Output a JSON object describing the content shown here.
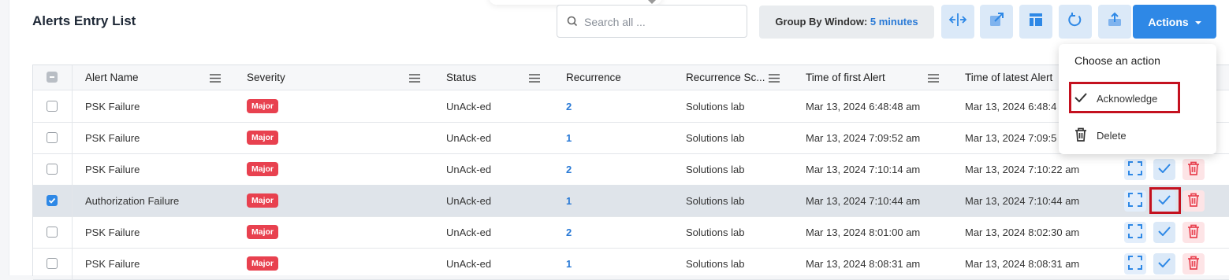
{
  "page": {
    "title": "Alerts Entry List"
  },
  "search": {
    "placeholder": "Search all ..."
  },
  "group_by": {
    "label": "Group By Window:",
    "value": "5 minutes"
  },
  "toolbar": {
    "buttons": [
      "resize-columns-icon",
      "open-external-icon",
      "layout-icon",
      "refresh-icon",
      "export-icon"
    ],
    "actions_label": "Actions"
  },
  "actions_menu": {
    "header": "Choose an action",
    "items": [
      {
        "label": "Acknowledge",
        "icon": "check-icon"
      },
      {
        "label": "Delete",
        "icon": "trash-icon"
      }
    ]
  },
  "table": {
    "columns": [
      "Alert Name",
      "Severity",
      "Status",
      "Recurrence",
      "Recurrence Sc...",
      "Time of first Alert",
      "Time of latest Alert"
    ],
    "rows": [
      {
        "selected": false,
        "name": "PSK Failure",
        "severity": "Major",
        "status": "UnAck-ed",
        "recurrence": "2",
        "scope": "Solutions lab",
        "first": "Mar 13, 2024 6:48:48 am",
        "latest": "Mar 13, 2024 6:48:4"
      },
      {
        "selected": false,
        "name": "PSK Failure",
        "severity": "Major",
        "status": "UnAck-ed",
        "recurrence": "1",
        "scope": "Solutions lab",
        "first": "Mar 13, 2024 7:09:52 am",
        "latest": "Mar 13, 2024 7:09:5"
      },
      {
        "selected": false,
        "name": "PSK Failure",
        "severity": "Major",
        "status": "UnAck-ed",
        "recurrence": "2",
        "scope": "Solutions lab",
        "first": "Mar 13, 2024 7:10:14 am",
        "latest": "Mar 13, 2024 7:10:22 am"
      },
      {
        "selected": true,
        "name": "Authorization Failure",
        "severity": "Major",
        "status": "UnAck-ed",
        "recurrence": "1",
        "scope": "Solutions lab",
        "first": "Mar 13, 2024 7:10:44 am",
        "latest": "Mar 13, 2024 7:10:44 am"
      },
      {
        "selected": false,
        "name": "PSK Failure",
        "severity": "Major",
        "status": "UnAck-ed",
        "recurrence": "2",
        "scope": "Solutions lab",
        "first": "Mar 13, 2024 8:01:00 am",
        "latest": "Mar 13, 2024 8:02:30 am"
      },
      {
        "selected": false,
        "name": "PSK Failure",
        "severity": "Major",
        "status": "UnAck-ed",
        "recurrence": "1",
        "scope": "Solutions lab",
        "first": "Mar 13, 2024 8:08:31 am",
        "latest": "Mar 13, 2024 8:08:31 am"
      }
    ]
  },
  "colors": {
    "accent": "#2e88e6",
    "badge_major": "#e8414f",
    "highlight": "#c4111f",
    "selected_row": "#dfe4ea"
  }
}
